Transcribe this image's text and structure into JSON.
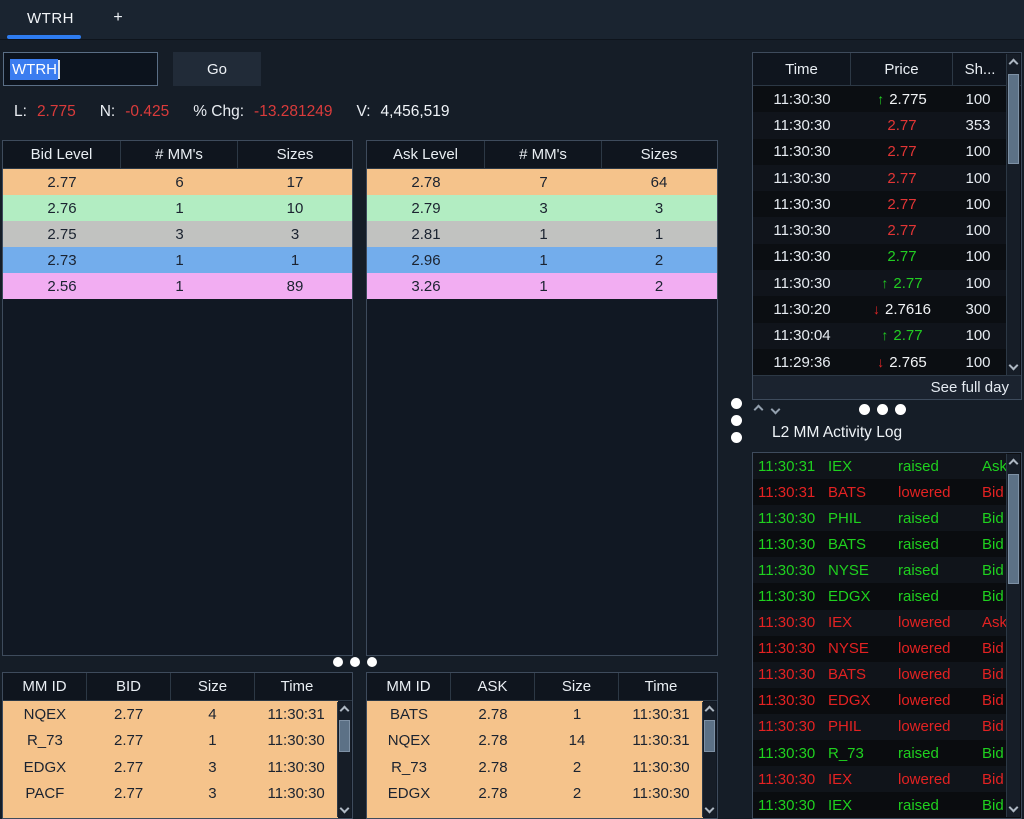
{
  "window": {
    "tab_label": "WTRH",
    "new_tab_label": "+"
  },
  "toolbar": {
    "symbol_input_value": "WTRH",
    "go_button_label": "Go"
  },
  "quote_bar": {
    "last_label": "L:",
    "last_value": "2.775",
    "net_label": "N:",
    "net_value": "-0.425",
    "pct_chg_label": "% Chg:",
    "pct_chg_value": "-13.281249",
    "volume_label": "V:",
    "volume_value": "4,456,519"
  },
  "bid_table": {
    "headers": [
      "Bid Level",
      "# MM's",
      "Sizes"
    ],
    "rows": [
      [
        "2.77",
        "6",
        "17"
      ],
      [
        "2.76",
        "1",
        "10"
      ],
      [
        "2.75",
        "3",
        "3"
      ],
      [
        "2.73",
        "1",
        "1"
      ],
      [
        "2.56",
        "1",
        "89"
      ]
    ]
  },
  "ask_table": {
    "headers": [
      "Ask Level",
      "# MM's",
      "Sizes"
    ],
    "rows": [
      [
        "2.78",
        "7",
        "64"
      ],
      [
        "2.79",
        "3",
        "3"
      ],
      [
        "2.81",
        "1",
        "1"
      ],
      [
        "2.96",
        "1",
        "2"
      ],
      [
        "3.26",
        "1",
        "2"
      ]
    ]
  },
  "time_sales": {
    "headers": [
      "Time",
      "Price",
      "Sh..."
    ],
    "footer_link": "See full day",
    "rows": [
      {
        "time": "11:30:30",
        "arrow": "up",
        "price": "2.775",
        "shares": "100",
        "color": "white"
      },
      {
        "time": "11:30:30",
        "arrow": "",
        "price": "2.77",
        "shares": "353",
        "color": "red"
      },
      {
        "time": "11:30:30",
        "arrow": "",
        "price": "2.77",
        "shares": "100",
        "color": "red"
      },
      {
        "time": "11:30:30",
        "arrow": "",
        "price": "2.77",
        "shares": "100",
        "color": "red"
      },
      {
        "time": "11:30:30",
        "arrow": "",
        "price": "2.77",
        "shares": "100",
        "color": "red"
      },
      {
        "time": "11:30:30",
        "arrow": "",
        "price": "2.77",
        "shares": "100",
        "color": "red"
      },
      {
        "time": "11:30:30",
        "arrow": "",
        "price": "2.77",
        "shares": "100",
        "color": "green"
      },
      {
        "time": "11:30:30",
        "arrow": "up",
        "price": "2.77",
        "shares": "100",
        "color": "green"
      },
      {
        "time": "11:30:20",
        "arrow": "down",
        "price": "2.7616",
        "shares": "300",
        "color": "white"
      },
      {
        "time": "11:30:04",
        "arrow": "up",
        "price": "2.77",
        "shares": "100",
        "color": "green"
      },
      {
        "time": "11:29:36",
        "arrow": "down",
        "price": "2.765",
        "shares": "100",
        "color": "white"
      }
    ]
  },
  "activity_log": {
    "title": "L2 MM Activity Log",
    "rows": [
      {
        "time": "11:30:31",
        "mm": "IEX",
        "action": "raised",
        "side": "Ask",
        "color": "green"
      },
      {
        "time": "11:30:31",
        "mm": "BATS",
        "action": "lowered",
        "side": "Bid",
        "color": "red"
      },
      {
        "time": "11:30:30",
        "mm": "PHIL",
        "action": "raised",
        "side": "Bid",
        "color": "green"
      },
      {
        "time": "11:30:30",
        "mm": "BATS",
        "action": "raised",
        "side": "Bid",
        "color": "green"
      },
      {
        "time": "11:30:30",
        "mm": "NYSE",
        "action": "raised",
        "side": "Bid",
        "color": "green"
      },
      {
        "time": "11:30:30",
        "mm": "EDGX",
        "action": "raised",
        "side": "Bid",
        "color": "green"
      },
      {
        "time": "11:30:30",
        "mm": "IEX",
        "action": "lowered",
        "side": "Ask",
        "color": "red"
      },
      {
        "time": "11:30:30",
        "mm": "NYSE",
        "action": "lowered",
        "side": "Bid",
        "color": "red"
      },
      {
        "time": "11:30:30",
        "mm": "BATS",
        "action": "lowered",
        "side": "Bid",
        "color": "red"
      },
      {
        "time": "11:30:30",
        "mm": "EDGX",
        "action": "lowered",
        "side": "Bid",
        "color": "red"
      },
      {
        "time": "11:30:30",
        "mm": "PHIL",
        "action": "lowered",
        "side": "Bid",
        "color": "red"
      },
      {
        "time": "11:30:30",
        "mm": "R_73",
        "action": "raised",
        "side": "Bid",
        "color": "green"
      },
      {
        "time": "11:30:30",
        "mm": "IEX",
        "action": "lowered",
        "side": "Bid",
        "color": "red"
      },
      {
        "time": "11:30:30",
        "mm": "IEX",
        "action": "raised",
        "side": "Bid",
        "color": "green"
      }
    ]
  },
  "mm_bid_table": {
    "headers": [
      "MM ID",
      "BID",
      "Size",
      "Time"
    ],
    "rows": [
      [
        "NQEX",
        "2.77",
        "4",
        "11:30:31"
      ],
      [
        "R_73",
        "2.77",
        "1",
        "11:30:30"
      ],
      [
        "EDGX",
        "2.77",
        "3",
        "11:30:30"
      ],
      [
        "PACF",
        "2.77",
        "3",
        "11:30:30"
      ]
    ]
  },
  "mm_ask_table": {
    "headers": [
      "MM ID",
      "ASK",
      "Size",
      "Time"
    ],
    "rows": [
      [
        "BATS",
        "2.78",
        "1",
        "11:30:31"
      ],
      [
        "NQEX",
        "2.78",
        "14",
        "11:30:31"
      ],
      [
        "R_73",
        "2.78",
        "2",
        "11:30:30"
      ],
      [
        "EDGX",
        "2.78",
        "2",
        "11:30:30"
      ]
    ]
  },
  "colors": {
    "accent_blue": "#2e7cf0",
    "selection_blue": "#3b7df0",
    "up_green": "#22cd22",
    "down_red": "#e23535",
    "neutral_white": "#f2f4f6",
    "level_row_colors": [
      "#f5c38b",
      "#b2edc2",
      "#c1c2c0",
      "#73adec",
      "#f2adf2"
    ],
    "mm_row_bg": "#f5c38b",
    "level_row_text": "#1b2330"
  }
}
